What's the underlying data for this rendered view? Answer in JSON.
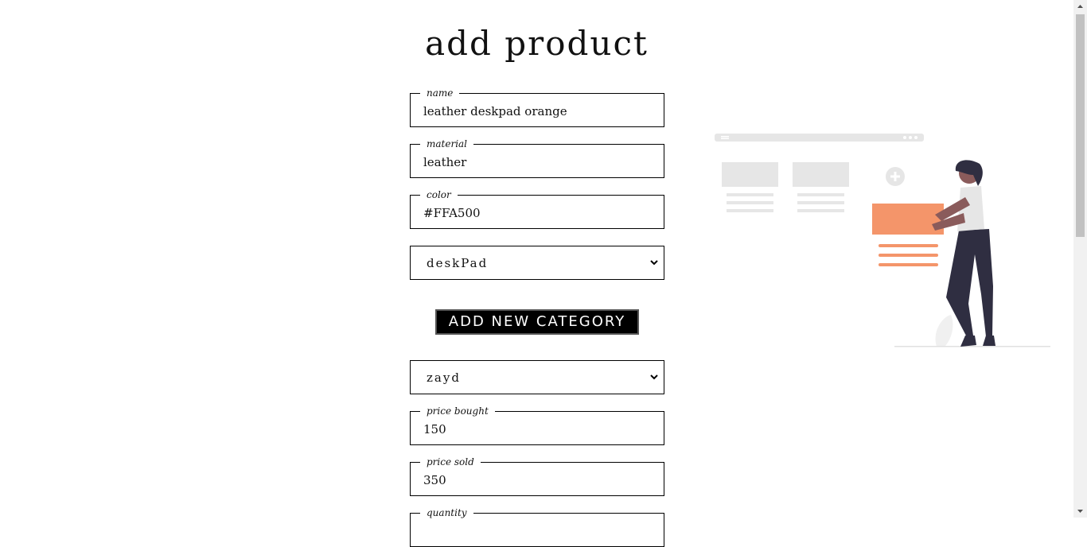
{
  "page": {
    "title": "add product"
  },
  "fields": {
    "name": {
      "label": "name",
      "value": "leather deskpad orange"
    },
    "material": {
      "label": "material",
      "value": "leather"
    },
    "color": {
      "label": "color",
      "value": "#FFA500"
    },
    "price_bought": {
      "label": "price bought",
      "value": "150"
    },
    "price_sold": {
      "label": "price sold",
      "value": "350"
    },
    "quantity": {
      "label": "quantity",
      "value": ""
    }
  },
  "category_select": {
    "value": "deskPad"
  },
  "add_category_button": {
    "label": "ADD NEW CATEGORY"
  },
  "supplier_select": {
    "value": "zayd"
  },
  "colors": {
    "accent": "#F4956A",
    "dark": "#2F2E41",
    "border": "#000000"
  },
  "illustration": {
    "icon": "person-adding-product-illustration"
  }
}
